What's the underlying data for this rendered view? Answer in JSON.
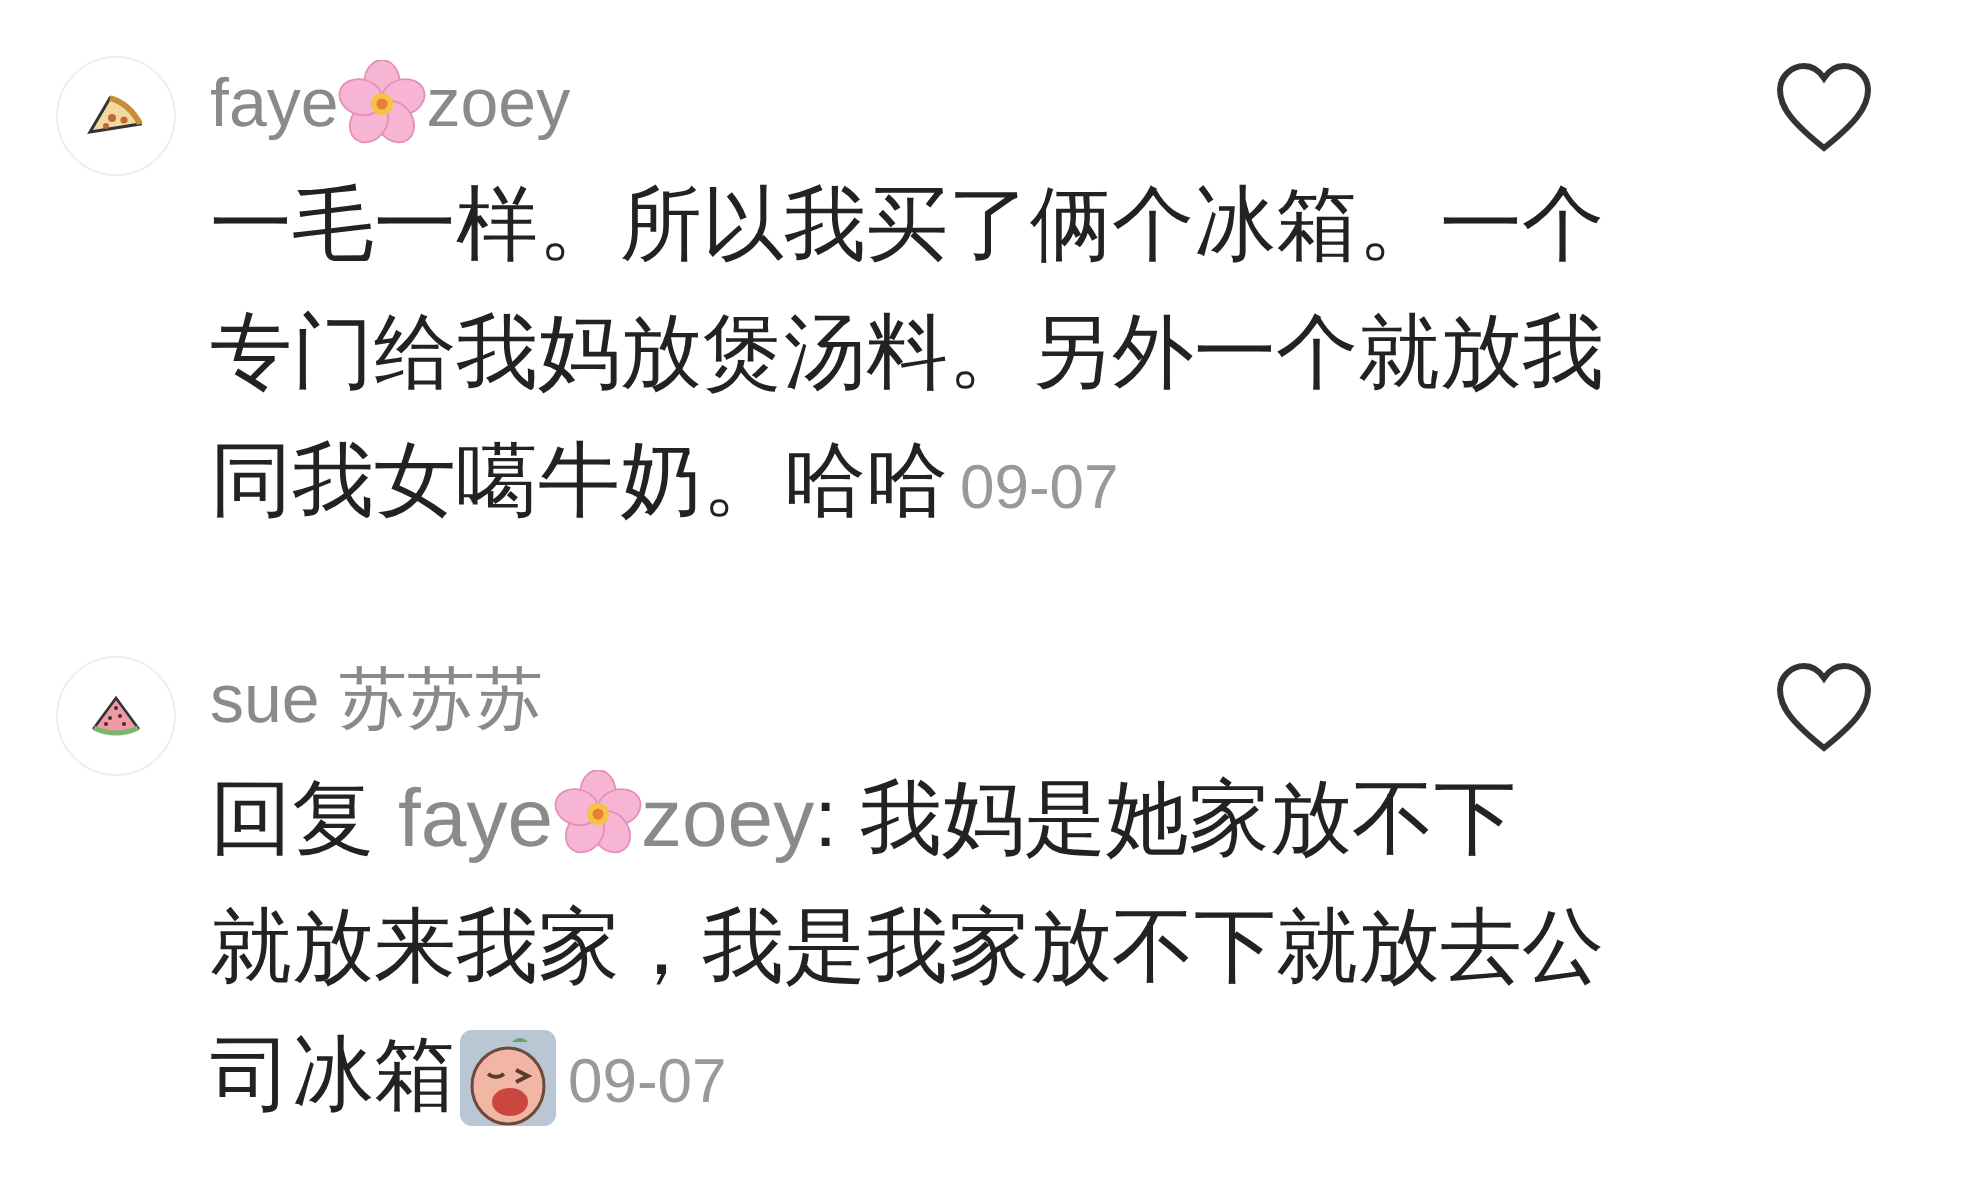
{
  "comments": [
    {
      "avatar": {
        "kind": "pizza"
      },
      "author": [
        "faye",
        "zoey"
      ],
      "liked": false,
      "lines": [
        "一毛一样。所以我买了俩个冰箱。一个",
        "专门给我妈放煲汤料。另外一个就放我",
        "同我女噶牛奶。哈哈"
      ],
      "date": "09-07"
    },
    {
      "avatar": {
        "kind": "watermelon"
      },
      "author": [
        "sue 苏苏苏"
      ],
      "liked": false,
      "reply_label": "回复",
      "reply_to": [
        "faye",
        "zoey"
      ],
      "lines": [
        ": 我妈是她家放不下",
        "就放来我家，我是我家放不下就放去公",
        "司冰箱"
      ],
      "sticker": true,
      "date": "09-07"
    }
  ]
}
